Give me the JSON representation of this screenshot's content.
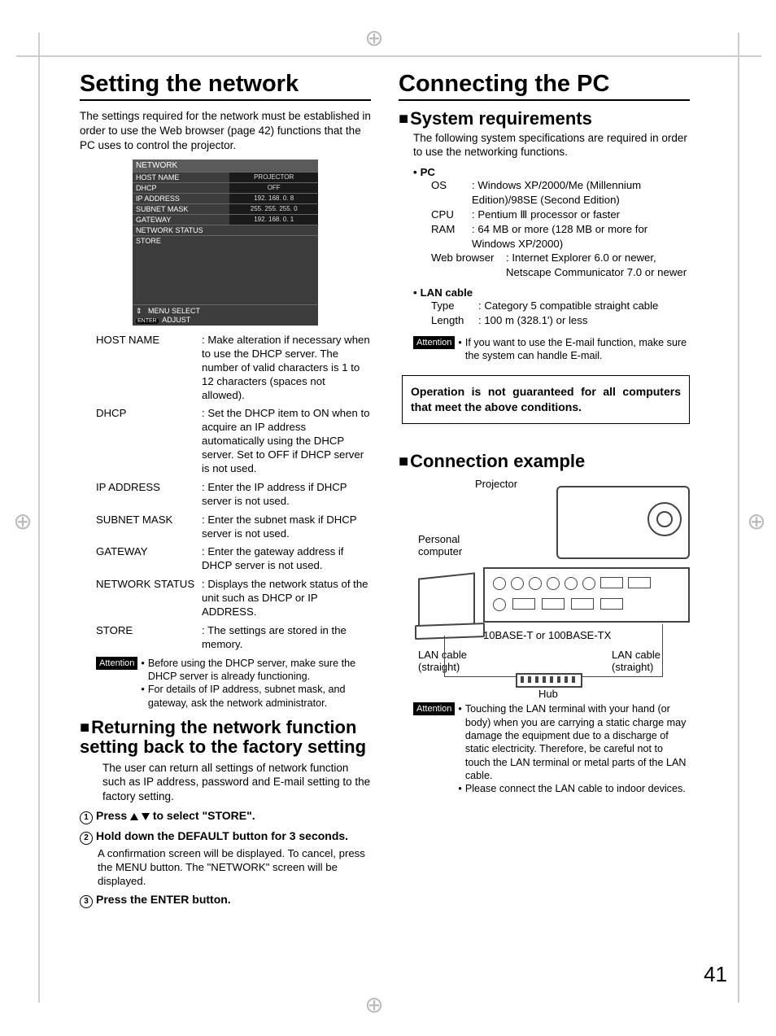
{
  "pageNumber": "41",
  "left": {
    "title": "Setting the network",
    "intro": "The settings required for the network must be established in order to use the Web browser (page 42) functions that the PC uses to control the projector.",
    "menu": {
      "title": "NETWORK",
      "rows": [
        {
          "label": "HOST NAME",
          "value": "PROJECTOR"
        },
        {
          "label": "DHCP",
          "value": "OFF"
        },
        {
          "label": "IP ADDRESS",
          "value": "192. 168.    0.    8"
        },
        {
          "label": "SUBNET MASK",
          "value": "255. 255. 255.    0"
        },
        {
          "label": "GATEWAY",
          "value": "192. 168.    0.    1"
        },
        {
          "label": "NETWORK STATUS",
          "value": ""
        },
        {
          "label": "STORE",
          "value": ""
        }
      ],
      "footer1": "MENU SELECT",
      "footer2": "ADJUST",
      "enter": "ENTER"
    },
    "defs": [
      {
        "term": "HOST NAME",
        "def": ": Make alteration if necessary when to use the DHCP server. The number of valid characters is 1 to 12 characters (spaces not allowed)."
      },
      {
        "term": "DHCP",
        "def": ": Set the DHCP item to ON when to acquire an IP address automatically using the DHCP server. Set to OFF if DHCP server is not used."
      },
      {
        "term": "IP ADDRESS",
        "def": ": Enter the IP address if DHCP server is not used."
      },
      {
        "term": "SUBNET MASK",
        "def": ": Enter the subnet mask if DHCP server is not used."
      },
      {
        "term": "GATEWAY",
        "def": ": Enter the gateway address if DHCP server is not used."
      },
      {
        "term": "NETWORK STATUS",
        "def": ": Displays the network status of the unit such as DHCP or IP ADDRESS."
      },
      {
        "term": "STORE",
        "def": ": The settings are stored in the memory."
      }
    ],
    "attention": {
      "label": "Attention",
      "items": [
        "Before using the DHCP server, make sure the DHCP server is already functioning.",
        "For details of IP address, subnet mask, and gateway, ask the network administrator."
      ]
    },
    "reset": {
      "heading": "Returning the network function setting back to the factory setting",
      "intro": "The user can return all settings of network function such as IP address, password and E-mail setting to the factory setting.",
      "steps": [
        {
          "n": "1",
          "head_pre": "Press  ",
          "head_post": "  to select \"STORE\".",
          "body": ""
        },
        {
          "n": "2",
          "head": "Hold down the DEFAULT button for 3 seconds.",
          "body": "A confirmation screen will be displayed. To cancel, press the MENU button. The \"NETWORK\" screen will be displayed."
        },
        {
          "n": "3",
          "head": "Press the ENTER button.",
          "body": ""
        }
      ]
    }
  },
  "right": {
    "title": "Connecting the PC",
    "sysreq": {
      "heading": "System requirements",
      "intro": "The following system specifications are required in order to use the networking functions.",
      "pcLabel": "PC",
      "pc": [
        {
          "k": "OS",
          "v": ": Windows XP/2000/Me (Millennium Edition)/98SE (Second Edition)"
        },
        {
          "k": "CPU",
          "v": ": Pentium Ⅲ processor or faster"
        },
        {
          "k": "RAM",
          "v": ": 64 MB or more (128 MB or more for Windows XP/2000)"
        }
      ],
      "browserK": "Web browser",
      "browserV": ": Internet Explorer 6.0 or newer, Netscape Communicator 7.0 or newer",
      "lanLabel": "LAN cable",
      "lan": [
        {
          "k": "Type",
          "v": ": Category 5 compatible straight cable"
        },
        {
          "k": "Length",
          "v": ": 100 m (328.1') or less"
        }
      ],
      "attention": {
        "label": "Attention",
        "items": [
          "If you want to use the E-mail function, make sure the system can handle E-mail."
        ]
      },
      "note": "Operation is not guaranteed for all computers that meet the above conditions."
    },
    "conn": {
      "heading": "Connection example",
      "labels": {
        "projector": "Projector",
        "pc": "Personal computer",
        "mid": "10BASE-T or 100BASE-TX",
        "cableL": "LAN cable (straight)",
        "cableR": "LAN cable (straight)",
        "hub": "Hub"
      },
      "attention": {
        "label": "Attention",
        "items": [
          "Touching the LAN terminal with your hand (or body) when you are carrying a static charge may damage the equipment due to a discharge of static electricity. Therefore, be careful not to touch the LAN terminal or metal parts of the LAN cable.",
          "Please connect the LAN cable to indoor devices."
        ]
      }
    }
  }
}
